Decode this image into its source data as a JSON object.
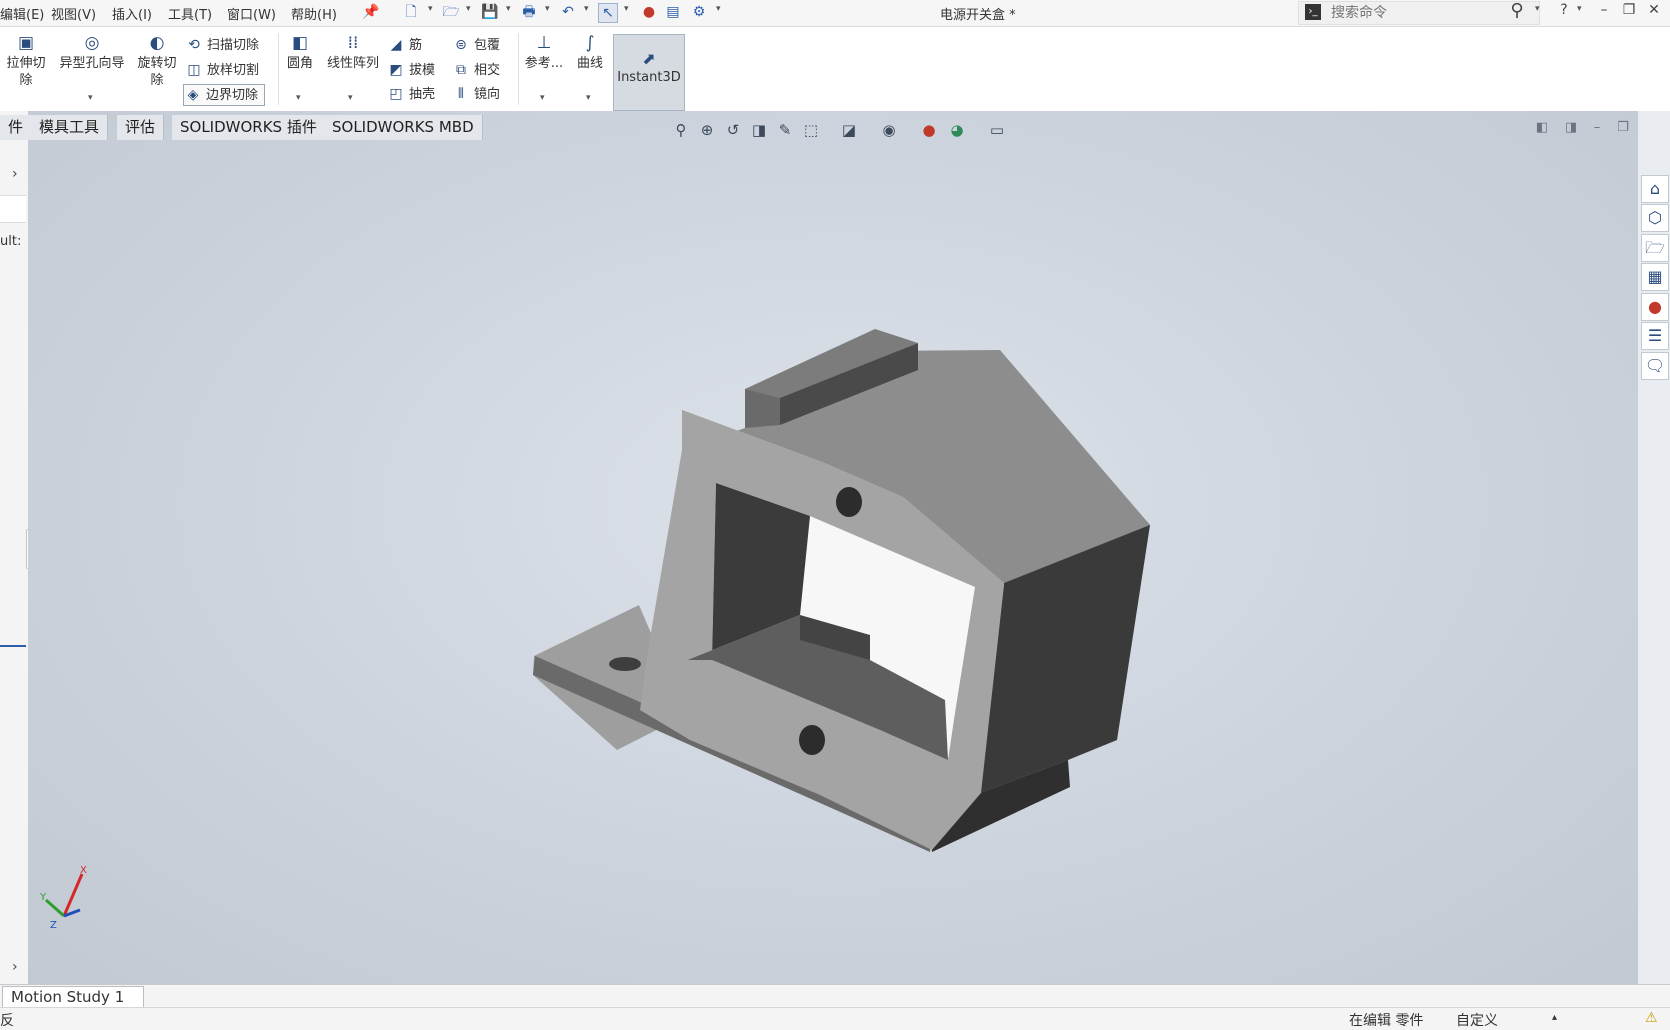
{
  "menu": {
    "items": [
      "编辑(E)",
      "视图(V)",
      "插入(I)",
      "工具(T)",
      "窗口(W)",
      "帮助(H)"
    ]
  },
  "title": {
    "document": "电源开关盒 *"
  },
  "search": {
    "placeholder": "搜索命令"
  },
  "ribbon": {
    "extrude_cut": "拉伸切除",
    "hole_wizard": "异型孔向导",
    "revolve_cut": "旋转切除",
    "swept_cut": "扫描切除",
    "lofted_cut": "放样切割",
    "boundary_cut": "边界切除",
    "fillet": "圆角",
    "linear_pattern": "线性阵列",
    "rib": "筋",
    "draft": "拔模",
    "shell": "抽壳",
    "wrap": "包覆",
    "intersect": "相交",
    "mirror": "镜向",
    "reference": "参考...",
    "curves": "曲线",
    "instant3d": "Instant3D"
  },
  "tabs": [
    "件",
    "模具工具",
    "评估",
    "SOLIDWORKS 插件",
    "SOLIDWORKS MBD"
  ],
  "left_panel": {
    "default_label": "ult:"
  },
  "bottom": {
    "motion_study": "Motion Study 1",
    "status_left": "反",
    "status_editing": "在编辑 零件",
    "status_custom": "自定义"
  },
  "triad": {
    "x": "X",
    "y": "Y",
    "z": "Z"
  },
  "icons": {
    "viewport_hud": [
      "zoom-to-fit-icon",
      "zoom-to-area-icon",
      "previous-view-icon",
      "section-view-icon",
      "dynamic-annotation-icon",
      "view-orientation-icon",
      "display-style-icon",
      "hide-show-items-icon",
      "edit-appearance-icon",
      "apply-scene-icon",
      "view-settings-icon"
    ],
    "task_pane": [
      "home-icon",
      "parts-library-icon",
      "file-explorer-icon",
      "view-palette-icon",
      "appearances-icon",
      "custom-properties-icon",
      "forum-icon"
    ]
  },
  "colors": {
    "viewport_bg": "#cbd2dc",
    "model_light": "#9a9a9a",
    "model_dark": "#3a3a3a",
    "accent": "#2b4d7e"
  }
}
